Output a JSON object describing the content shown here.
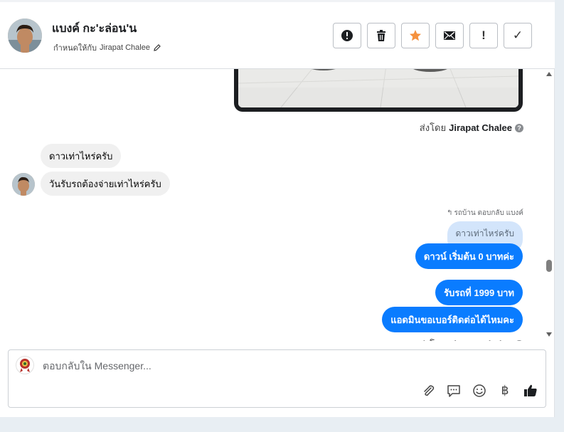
{
  "header": {
    "contact_name": "แบงค์ กะ'ะล่อน'น",
    "assign_prefix": "กำหนดให้กับ",
    "assignee": "Jirapat Chalee"
  },
  "actions": {
    "spam_icon": "exclamation-circle-icon",
    "delete_icon": "trash-icon",
    "star_icon": "star-icon",
    "star_color": "#f5913e",
    "mail_icon": "envelope-icon",
    "follow_up_glyph": "!",
    "done_glyph": "✓"
  },
  "messages": {
    "sent_by_prefix": "ส่งโดย",
    "sent_by_name": "Jirapat Chalee",
    "incoming": [
      {
        "text": "ดาวเท่าไหร่ครับ"
      },
      {
        "text": "วันรับรถต้องจ่ายเท่าไหร่ครับ"
      }
    ],
    "reply_note": "รถบ้าน ตอบกลับ แบงค์",
    "quoted_text": "ดาวเท่าไหร่ครับ",
    "outgoing": [
      {
        "text": "ดาวน์ เริ่มต้น 0 บาทค่ะ"
      },
      {
        "text": "รับรถที่ 1999 บาท"
      },
      {
        "text": "แอดมินขอเบอร์ติดต่อได้ไหมคะ"
      }
    ],
    "outgoing_color": "#0a7cff"
  },
  "composer": {
    "placeholder": "ตอบกลับใน Messenger...",
    "baht_glyph": "฿"
  }
}
